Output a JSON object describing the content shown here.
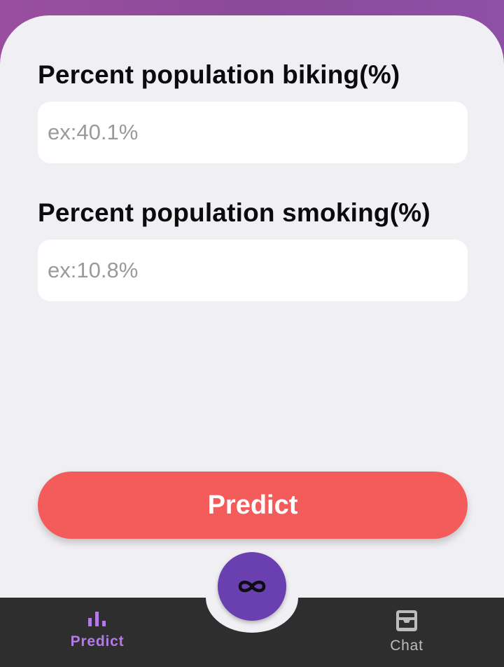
{
  "form": {
    "biking_label": "Percent population biking(%)",
    "biking_placeholder": "ex:40.1%",
    "smoking_label": "Percent population smoking(%)",
    "smoking_placeholder": "ex:10.8%",
    "predict_label": "Predict"
  },
  "bottom_nav": {
    "items": [
      {
        "label": "Predict",
        "icon": "bar-chart-icon",
        "active": true
      },
      {
        "label": "Chat",
        "icon": "inbox-tray-icon",
        "active": false
      }
    ],
    "fab_icon": "infinity-icon"
  },
  "colors": {
    "header_gradient": "#9a4f9e",
    "card_background": "#f0eff3",
    "predict_button": "#f45b5b",
    "fab": "#6a3fb0",
    "bottom_bar": "#2e2e2e",
    "nav_active": "#b47ae6",
    "nav_inactive": "#bdbdbd"
  }
}
